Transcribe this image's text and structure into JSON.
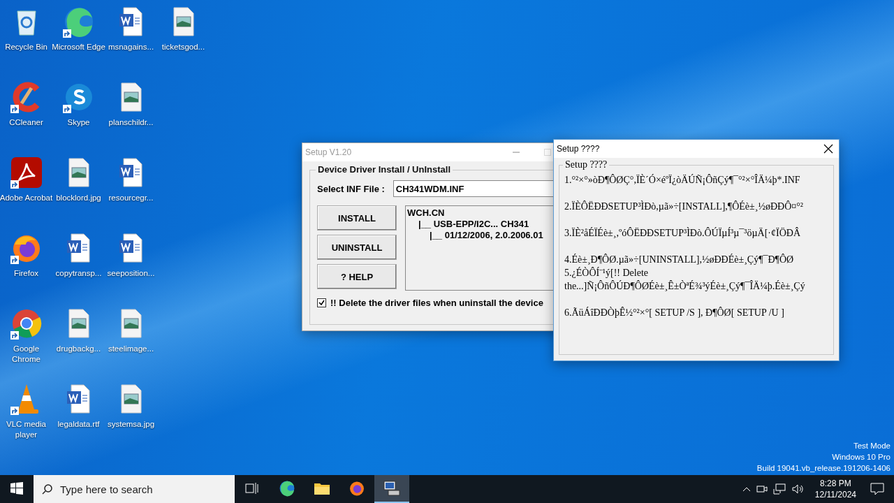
{
  "desktop_rows": [
    [
      {
        "label": "Recycle Bin",
        "kind": "recycle",
        "shortcut": false
      },
      {
        "label": "Microsoft Edge",
        "kind": "edge",
        "shortcut": true
      },
      {
        "label": "msnagains...",
        "kind": "word",
        "shortcut": false
      },
      {
        "label": "ticketsgod...",
        "kind": "image",
        "shortcut": false
      }
    ],
    [
      {
        "label": "CCleaner",
        "kind": "ccleaner",
        "shortcut": true
      },
      {
        "label": "Skype",
        "kind": "skype",
        "shortcut": true
      },
      {
        "label": "planschildr...",
        "kind": "image",
        "shortcut": false
      }
    ],
    [
      {
        "label": "Adobe Acrobat",
        "kind": "acrobat",
        "shortcut": true
      },
      {
        "label": "blocklord.jpg",
        "kind": "image",
        "shortcut": false
      },
      {
        "label": "resourcegr...",
        "kind": "word",
        "shortcut": false
      }
    ],
    [
      {
        "label": "Firefox",
        "kind": "firefox",
        "shortcut": true
      },
      {
        "label": "copytransp...",
        "kind": "word",
        "shortcut": false
      },
      {
        "label": "seeposition...",
        "kind": "word",
        "shortcut": false
      }
    ],
    [
      {
        "label": "Google Chrome",
        "kind": "chrome",
        "shortcut": true
      },
      {
        "label": "drugbackg...",
        "kind": "image",
        "shortcut": false
      },
      {
        "label": "steelimage...",
        "kind": "image",
        "shortcut": false
      }
    ],
    [
      {
        "label": "VLC media player",
        "kind": "vlc",
        "shortcut": true
      },
      {
        "label": "legaldata.rtf",
        "kind": "word",
        "shortcut": false
      },
      {
        "label": "systemsa.jpg",
        "kind": "image",
        "shortcut": false
      }
    ]
  ],
  "setup_window": {
    "title": "Setup V1.20",
    "group_title": "Device Driver Install / UnInstall",
    "inf_label": "Select INF File :",
    "inf_value": "CH341WDM.INF",
    "buttons": [
      "INSTALL",
      "UNINSTALL",
      "? HELP"
    ],
    "tree": [
      {
        "label": "WCH.CN",
        "children": [
          {
            "label": "|__ USB-EPP/I2C... CH341",
            "children": [
              {
                "label": "|__ 01/12/2006, 2.0.2006.01"
              }
            ]
          }
        ]
      }
    ],
    "delete_option": {
      "label": "!! Delete the driver files when uninstall the device",
      "checked": true
    }
  },
  "help_dialog": {
    "title": "Setup ????",
    "group_title": "Setup ????",
    "blocks": [
      [
        "1.°²×°»òÐ¶ÔØÇ°,ÏÈ´Ó×éºÏ¿òÄÚÑ¡ÔñÇý¶¯°²×°ÎÄ¼þ*.INF"
      ],
      [
        "2.ÏÈÔËÐÐSETUP³ÌÐò,µã»÷[INSTALL],¶ÔÉè±¸½øÐÐÔ¤°²"
      ],
      [
        "3.ÏÈ²åÉÏÉè±¸,ºóÔËÐÐSETUP³ÌÐò.ÔÚÏµÍ³µ¯³öµÄ[·¢ÏÖÐÂ"
      ],
      [
        "4.Éè±¸Ð¶ÔØ.µã»÷[UNINSTALL],½øÐÐÉè±¸Çý¶¯Ð¶ÔØ",
        "5.¿ÉÒÔÍ¨¹ý[!! Delete the...]Ñ¡ÔñÔÚÐ¶ÔØÉè±¸Ê±ÒªÉ¾³ýÉè±¸Çý¶¯ÎÄ¼þ.Éè±¸Çý"
      ],
      [
        "6.ÃüÁîÐÐÒþÊ½°²×°[ SETUP /S ], Ð¶ÔØ[ SETUP /U ]"
      ]
    ]
  },
  "system_info": [
    "Test Mode",
    "Windows 10 Pro",
    "Build 19041.vb_release.191206-1406"
  ],
  "taskbar": {
    "search_placeholder": "Type here to search",
    "apps": [
      {
        "kind": "taskview",
        "active": false
      },
      {
        "kind": "edge",
        "active": false
      },
      {
        "kind": "explorer",
        "active": false
      },
      {
        "kind": "firefox",
        "active": false
      },
      {
        "kind": "setup",
        "active": true
      }
    ],
    "time": "8:28 PM",
    "date": "12/11/2024"
  }
}
